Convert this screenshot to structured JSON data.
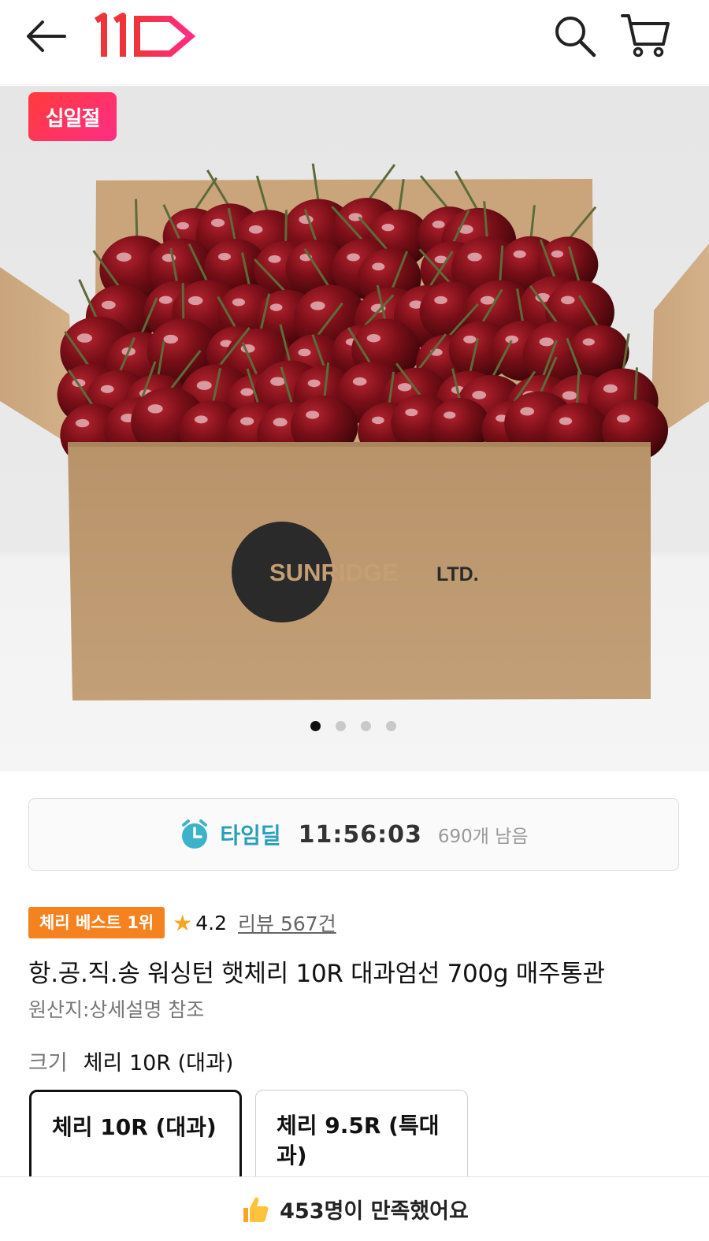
{
  "header": {
    "back_icon": "arrow-left-icon",
    "logo_text": "11",
    "search_icon": "search-icon",
    "cart_icon": "cart-icon"
  },
  "hero": {
    "sale_badge": "십일절",
    "box_brand": "SUNRIDGE",
    "box_brand_suffix": "LTD.",
    "carousel_total": 4,
    "carousel_active": 1
  },
  "timedeal": {
    "icon": "alarm-clock-icon",
    "label": "타임딜",
    "time": "11:56:03",
    "remaining": "690개 남음"
  },
  "product": {
    "best_badge": "체리 베스트 1위",
    "rating": "4.2",
    "reviews": "리뷰 567건",
    "title": "항.공.직.송 워싱턴 햇체리 10R 대과엄선 700g 매주통관",
    "origin": "원산지:상세설명 참조",
    "size_label": "크기",
    "size_value": "체리 10R (대과)",
    "options": [
      {
        "label": "체리 10R (대과)",
        "selected": true
      },
      {
        "label": "체리 9.5R (특대과)",
        "selected": false
      }
    ]
  },
  "bottom": {
    "icon": "thumbs-up-icon",
    "text": "453명이 만족했어요"
  },
  "colors": {
    "brand_red": "#f0343c",
    "brand_pink": "#ff2d85",
    "timedeal_teal": "#2aa0b8",
    "best_orange": "#f5821f",
    "star_yellow": "#f5a623"
  }
}
